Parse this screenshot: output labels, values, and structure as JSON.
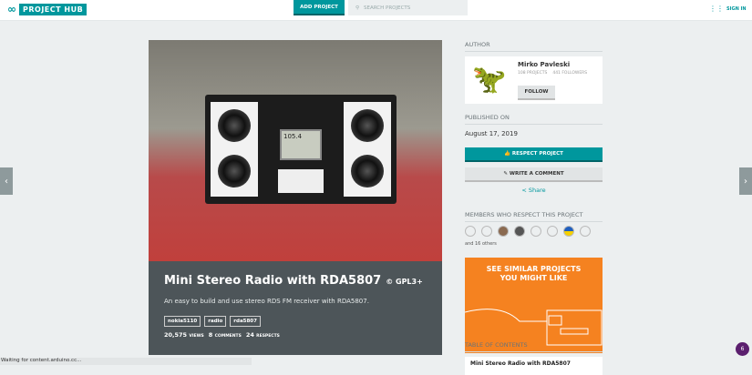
{
  "header": {
    "logo": "PROJECT HUB",
    "add_project": "ADD PROJECT",
    "search_placeholder": "SEARCH PROJECTS",
    "sign_in": "SIGN IN"
  },
  "project": {
    "title": "Mini Stereo Radio with RDA5807",
    "license": "© GPL3+",
    "description": "An easy to build and use stereo RDS FM receiver with RDA5807.",
    "tags": [
      "nokia5110",
      "radio",
      "rda5807"
    ],
    "views": "20,575",
    "views_label": "VIEWS",
    "comments": "8",
    "comments_label": "COMMENTS",
    "respects": "24",
    "respects_label": "RESPECTS",
    "lcd_text": "105.4"
  },
  "author": {
    "heading": "AUTHOR",
    "name": "Mirko Pavleski",
    "projects": "108 PROJECTS",
    "followers": "441 FOLLOWERS",
    "follow": "FOLLOW"
  },
  "published": {
    "heading": "PUBLISHED ON",
    "date": "August 17, 2019"
  },
  "actions": {
    "respect": "RESPECT PROJECT",
    "comment": "WRITE A COMMENT",
    "share": "Share"
  },
  "members": {
    "heading": "MEMBERS WHO RESPECT THIS PROJECT",
    "others": "and 16 others"
  },
  "promo": {
    "line1": "SEE SIMILAR PROJECTS",
    "line2": "YOU MIGHT LIKE"
  },
  "toc": {
    "heading": "TABLE OF CONTENTS",
    "first": "Mini Stereo Radio with RDA5807"
  },
  "status_bar": "Waiting for content.arduino.cc...",
  "notification_count": "6"
}
